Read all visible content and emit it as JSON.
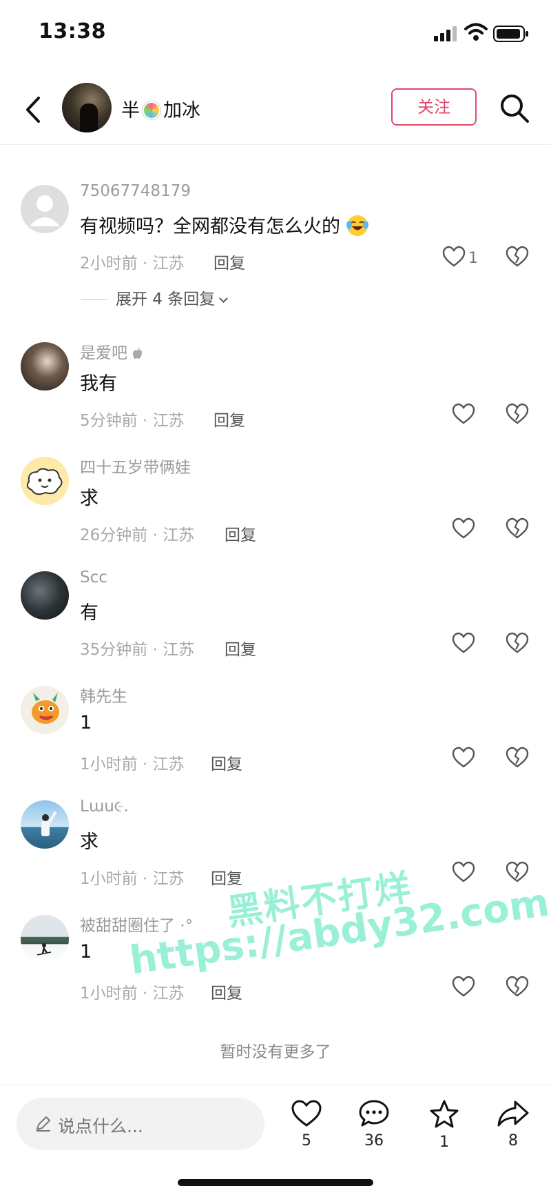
{
  "status_bar": {
    "time": "13:38"
  },
  "header": {
    "username_before": "半",
    "username_after": "加冰",
    "follow_label": "关注"
  },
  "comments": [
    {
      "username": "75067748179",
      "text": "有视频吗？全网都没有怎么火的",
      "time_location": "2小时前 · 江苏",
      "reply_label": "回复",
      "like_count": "1",
      "expand_label": "展开 4 条回复",
      "emoji": "laughing-tears-emoji"
    },
    {
      "username": "是爱吧",
      "text": "我有",
      "time_location": "5分钟前 · 江苏",
      "reply_label": "回复",
      "like_count": ""
    },
    {
      "username": "四十五岁带俩娃",
      "text": "求",
      "time_location": "26分钟前 · 江苏",
      "reply_label": "回复",
      "like_count": ""
    },
    {
      "username": "Scc",
      "text": "有",
      "time_location": "35分钟前 · 江苏",
      "reply_label": "回复",
      "like_count": ""
    },
    {
      "username": "韩先生",
      "text": "1",
      "time_location": "1小时前 · 江苏",
      "reply_label": "回复",
      "like_count": ""
    },
    {
      "username": "Lɯu૯.",
      "text": "求",
      "time_location": "1小时前 · 江苏",
      "reply_label": "回复",
      "like_count": ""
    },
    {
      "username": "被甜甜圈住了 ·°",
      "text": "1",
      "time_location": "1小时前 · 江苏",
      "reply_label": "回复",
      "like_count": ""
    }
  ],
  "no_more_label": "暂时没有更多了",
  "watermark": {
    "line1": "黑料不打烊",
    "line2": "https://abdy32.com"
  },
  "bottom_bar": {
    "input_placeholder": "说点什么...",
    "like_count": "5",
    "comment_count": "36",
    "favorite_count": "1",
    "share_count": "8"
  },
  "colors": {
    "accent": "#e3486a",
    "watermark": "#78ebc8"
  }
}
